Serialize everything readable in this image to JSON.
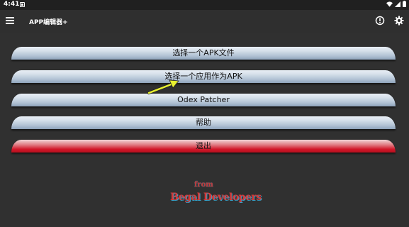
{
  "status_bar": {
    "time": "4:41"
  },
  "app_bar": {
    "title": "APP编辑器+"
  },
  "buttons": {
    "select_apk": "选择一个APK文件",
    "select_app": "选择一个应用作为APK",
    "odex_patcher": "Odex Patcher",
    "help": "帮助",
    "exit": "退出"
  },
  "logo": {
    "from": "from",
    "brand": "Begal Developers"
  },
  "colors": {
    "background": "#303030",
    "exit_red": "#d21628",
    "annotation_arrow": "#e8f030"
  }
}
